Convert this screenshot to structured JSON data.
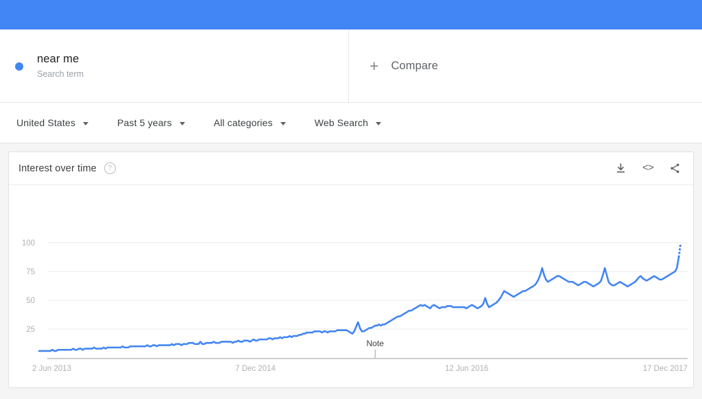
{
  "topbar": {
    "color": "#4285f4"
  },
  "query": {
    "term": "near me",
    "subtitle": "Search term",
    "dot_color": "#4285f4",
    "compare_label": "Compare",
    "compare_icon": "plus-icon"
  },
  "filters": [
    {
      "label": "United States",
      "name": "location"
    },
    {
      "label": "Past 5 years",
      "name": "time-range"
    },
    {
      "label": "All categories",
      "name": "category"
    },
    {
      "label": "Web Search",
      "name": "search-type"
    }
  ],
  "card": {
    "title": "Interest over time",
    "help_icon": "question-mark-icon",
    "actions": [
      {
        "name": "download-icon",
        "label": "Download"
      },
      {
        "name": "embed-icon",
        "label": "<>"
      },
      {
        "name": "share-icon",
        "label": "Share"
      }
    ]
  },
  "chart_data": {
    "type": "line",
    "title": "Interest over time",
    "xlabel": "",
    "ylabel": "",
    "ylim": [
      0,
      100
    ],
    "yticks": [
      25,
      50,
      75,
      100
    ],
    "grid": true,
    "legend_position": "none",
    "line_color": "#4285f4",
    "x_tick_labels": [
      "2 Jun 2013",
      "7 Dec 2014",
      "12 Jun 2016",
      "17 Dec 2017"
    ],
    "x_tick_positions": [
      0,
      0.325,
      0.655,
      0.965
    ],
    "annotations": [
      {
        "label": "Note",
        "x_fraction": 0.512
      }
    ],
    "partial_data_note": "final dotted segment indicates incomplete/partial data",
    "series": [
      {
        "name": "near me",
        "color": "#4285f4",
        "values": [
          6,
          6,
          6,
          6,
          6,
          6,
          6,
          7,
          6,
          6,
          7,
          7,
          7,
          7,
          7,
          7,
          7,
          7,
          8,
          7,
          7,
          8,
          8,
          7,
          8,
          8,
          8,
          8,
          8,
          9,
          8,
          8,
          8,
          8,
          9,
          8,
          9,
          9,
          9,
          9,
          9,
          9,
          9,
          9,
          10,
          9,
          9,
          9,
          10,
          10,
          10,
          10,
          10,
          10,
          10,
          10,
          10,
          11,
          10,
          10,
          11,
          11,
          10,
          11,
          11,
          11,
          11,
          11,
          11,
          11,
          12,
          11,
          12,
          12,
          12,
          11,
          12,
          12,
          12,
          13,
          13,
          13,
          12,
          12,
          12,
          14,
          12,
          12,
          13,
          13,
          13,
          13,
          14,
          13,
          13,
          13,
          14,
          14,
          14,
          14,
          14,
          14,
          13,
          14,
          14,
          15,
          14,
          14,
          15,
          15,
          15,
          14,
          15,
          16,
          15,
          15,
          16,
          16,
          16,
          16,
          16,
          17,
          17,
          16,
          17,
          17,
          17,
          18,
          17,
          18,
          18,
          18,
          19,
          18,
          19,
          19,
          19,
          20,
          20,
          21,
          21,
          22,
          22,
          22,
          22,
          23,
          23,
          23,
          23,
          22,
          23,
          23,
          22,
          23,
          23,
          23,
          23,
          24,
          24,
          24,
          24,
          24,
          24,
          23,
          22,
          21,
          23,
          27,
          31,
          26,
          23,
          23,
          24,
          25,
          26,
          26,
          27,
          28,
          28,
          29,
          28,
          29,
          29,
          30,
          31,
          32,
          33,
          34,
          35,
          36,
          36,
          37,
          38,
          39,
          40,
          41,
          41,
          42,
          43,
          44,
          45,
          46,
          45,
          46,
          45,
          44,
          43,
          45,
          46,
          45,
          44,
          43,
          44,
          44,
          44,
          45,
          45,
          45,
          44,
          44,
          44,
          44,
          44,
          44,
          44,
          43,
          44,
          45,
          46,
          45,
          44,
          43,
          44,
          45,
          47,
          52,
          47,
          44,
          45,
          46,
          47,
          48,
          50,
          52,
          55,
          58,
          57,
          56,
          55,
          54,
          53,
          54,
          55,
          56,
          57,
          58,
          58,
          59,
          60,
          61,
          62,
          63,
          65,
          68,
          72,
          78,
          72,
          68,
          66,
          67,
          68,
          69,
          70,
          71,
          71,
          70,
          69,
          68,
          67,
          66,
          66,
          66,
          65,
          64,
          63,
          64,
          65,
          66,
          66,
          65,
          64,
          63,
          62,
          63,
          64,
          65,
          67,
          72,
          78,
          72,
          66,
          64,
          63,
          63,
          64,
          65,
          66,
          65,
          64,
          63,
          62,
          63,
          64,
          65,
          66,
          68,
          70,
          71,
          69,
          68,
          67,
          68,
          69,
          70,
          71,
          70,
          69,
          68,
          68,
          69,
          70,
          71,
          72,
          73,
          74,
          75,
          78,
          88,
          100
        ],
        "dotted_from_index": 337
      }
    ]
  }
}
